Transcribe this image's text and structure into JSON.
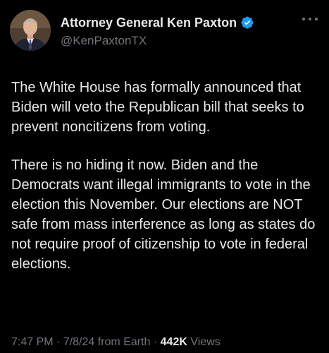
{
  "colors": {
    "background": "#000000",
    "primary_text": "#e7e9ea",
    "secondary_text": "#71767b",
    "verified_badge": "#1d9bf0"
  },
  "author": {
    "display_name": "Attorney General Ken Paxton",
    "handle": "@KenPaxtonTX",
    "verified_icon": "verified-badge-icon",
    "avatar_icon": "profile-photo"
  },
  "menu": {
    "icon": "more-options-icon"
  },
  "tweet": {
    "paragraphs": [
      "The White House has formally announced that Biden will veto the Republican bill that seeks to prevent noncitizens from voting.",
      "There is no hiding it now. Biden and the Democrats want illegal immigrants to vote in the election this November. Our elections are NOT safe from mass interference as long as states do not require proof of citizenship to vote in federal elections."
    ]
  },
  "meta": {
    "time": "7:47 PM",
    "separator": " · ",
    "date": "7/8/24",
    "source": " from Earth",
    "views_count": "442K",
    "views_label": " Views"
  }
}
